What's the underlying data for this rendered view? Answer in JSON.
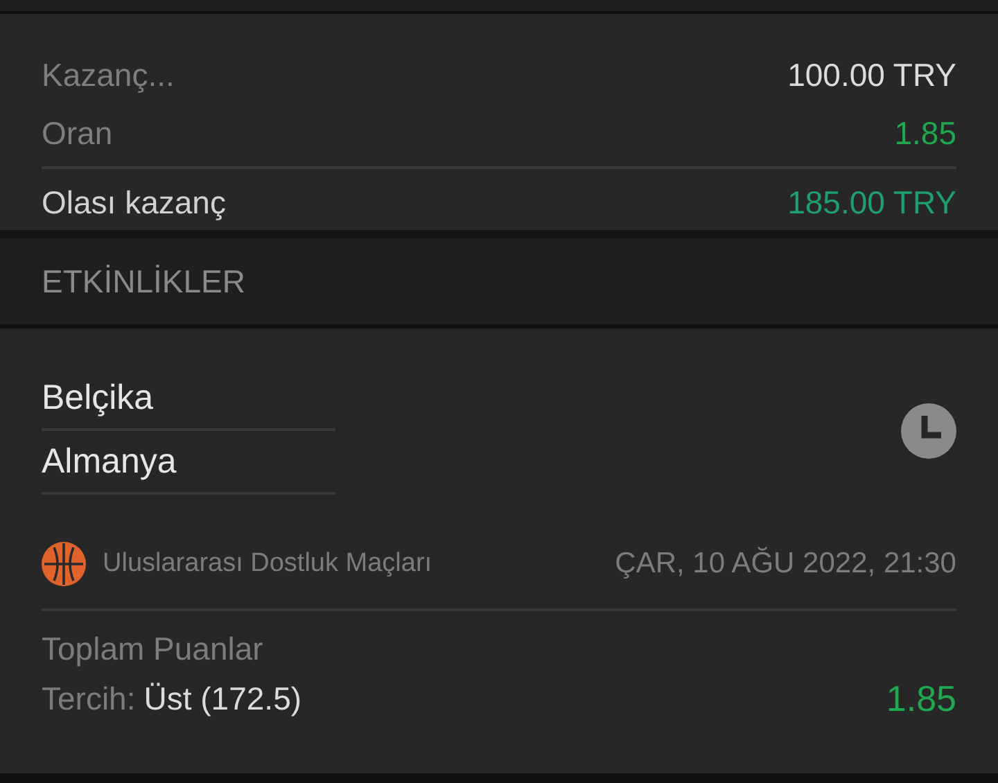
{
  "summary": [
    {
      "kind": "line",
      "label": "Kazanç...",
      "value": "100.00 TRY",
      "color": "#dcdcdc"
    },
    {
      "kind": "line",
      "label": "Oran",
      "value": "1.85",
      "color": "#1fa84f"
    },
    {
      "kind": "total",
      "label": "Olası kazanç",
      "value": "185.00 TRY",
      "color": "#1f9e6e"
    }
  ],
  "section": {
    "title": "ETKİNLİKLER"
  },
  "event": {
    "teams": [
      "Belçika",
      "Almanya"
    ],
    "league": "Uluslararası Dostluk Maçları",
    "datetime": "ÇAR, 10 AĞU 2022, 21:30",
    "market": "Toplam Puanlar",
    "pick_label": "Tercih:",
    "pick_value": "Üst (172.5)",
    "odds": "1.85"
  }
}
